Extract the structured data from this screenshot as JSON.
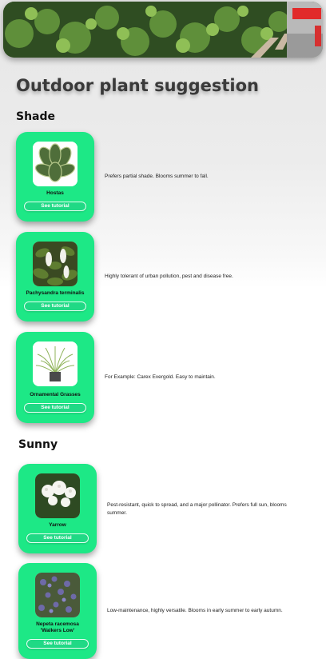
{
  "page_title": "Outdoor plant suggestion",
  "sections": [
    {
      "title": "Shade",
      "plants": [
        {
          "name": "Hostas",
          "button": "See tutorial",
          "description": "Prefers partial shade. Blooms summer to fall."
        },
        {
          "name": "Pachysandra terminalis",
          "button": "See tutorial",
          "description": "Highly tolerant of urban pollution, pest and disease free."
        },
        {
          "name": "Ornamental Grasses",
          "button": "See tutorial",
          "description": "For Example: Carex Evergold. Easy to maintain."
        }
      ]
    },
    {
      "title": "Sunny",
      "plants": [
        {
          "name": "Yarrow",
          "button": "See tutorial",
          "description": "Pest-resistant, quick to spread, and a major pollinator. Prefers full sun, blooms summer."
        },
        {
          "name": "Nepeta racemosa 'Walkers Low'",
          "button": "See tutorial",
          "description": "Low-maintenance, highly versatile. Blooms in early summer to early autumn."
        }
      ]
    }
  ],
  "colors": {
    "card": "#1de886",
    "button_bg": "#20d985",
    "title_text": "#3a3a3a"
  }
}
